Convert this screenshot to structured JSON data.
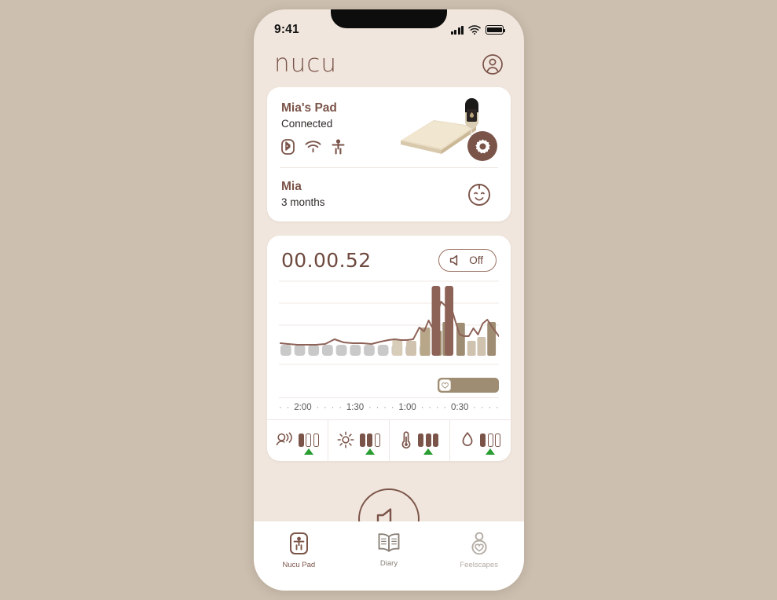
{
  "status_bar": {
    "time": "9:41",
    "cellular_icon": "signal-bars-icon",
    "wifi_icon": "wifi-icon",
    "battery_icon": "battery-full-icon"
  },
  "header": {
    "logo": "nucu",
    "account_icon": "account-circle-icon"
  },
  "device_card": {
    "name": "Mia's Pad",
    "status": "Connected",
    "connectivity_icons": [
      "bluetooth-icon",
      "wifi-icon",
      "baby-icon"
    ],
    "product_image": "nucu-pad-illustration",
    "settings_icon": "gear-icon",
    "baby": {
      "name": "Mia",
      "age": "3 months",
      "avatar_icon": "baby-face-icon"
    }
  },
  "monitor_card": {
    "timer": "00.00.52",
    "sound_toggle": {
      "icon": "speaker-icon",
      "label": "Off"
    },
    "progress": {
      "badge_icon": "heart-icon"
    },
    "axis_labels": [
      "2:00",
      "1:30",
      "1:00",
      "0:30"
    ],
    "sensors": [
      {
        "icon": "sound-icon",
        "level": 1,
        "max": 3,
        "trend": "up"
      },
      {
        "icon": "brightness-icon",
        "level": 2,
        "max": 3,
        "trend": "up"
      },
      {
        "icon": "temperature-icon",
        "level": 3,
        "max": 3,
        "trend": "up"
      },
      {
        "icon": "humidity-icon",
        "level": 1,
        "max": 3,
        "trend": "up"
      }
    ]
  },
  "play_button": {
    "icon": "speaker-icon"
  },
  "tab_bar": {
    "tabs": [
      {
        "label": "Nucu Pad",
        "icon": "nucu-pad-icon",
        "active": true
      },
      {
        "label": "Diary",
        "icon": "book-icon",
        "active": false
      },
      {
        "label": "Feelscapes",
        "icon": "feelscapes-icon",
        "active": false
      }
    ]
  },
  "colors": {
    "page_background": "#ccbfaf",
    "screen_background": "#f0e6dd",
    "card": "#ffffff",
    "brand_brown": "#7b5449",
    "accent_tan": "#9e8c73",
    "bar_dark": "#8d6257",
    "bar_light": "#cfc2ae",
    "trend_green": "#2a9d32",
    "placeholder_gray": "#c9c9c9"
  },
  "chart_data": {
    "type": "bar",
    "title": "",
    "xlabel": "",
    "ylabel": "",
    "x_tick_labels": [
      "2:00",
      "1:30",
      "1:00",
      "0:30"
    ],
    "grid": true,
    "ylim": [
      0,
      100
    ],
    "placeholder_slots": 11,
    "bars": [
      {
        "value": 20,
        "color": "#d8cdb9"
      },
      {
        "value": 18,
        "color": "#cfc2ae"
      },
      {
        "value": 34,
        "color": "#b8a689"
      },
      {
        "value": 30,
        "color": "#a89madd"
      },
      {
        "value": 41,
        "color": "#9e8c73"
      },
      {
        "value": 88,
        "color": "#8d6257"
      },
      {
        "value": 88,
        "color": "#8d6257"
      },
      {
        "value": 40,
        "color": "#9e8c73"
      },
      {
        "value": 18,
        "color": "#cfc2ae"
      },
      {
        "value": 24,
        "color": "#cfc2ae"
      },
      {
        "value": 24,
        "color": "#cfc2ae"
      },
      {
        "value": 42,
        "color": "#9e8c73"
      }
    ],
    "line_series": {
      "name": "sound-level",
      "color": "#8d6257",
      "values": [
        16,
        15,
        14,
        14,
        14,
        15,
        22,
        17,
        16,
        16,
        15,
        18,
        20,
        21,
        20,
        20,
        21,
        37,
        30,
        45,
        34,
        48,
        70,
        62,
        66,
        44,
        26,
        23,
        23,
        33,
        26,
        40,
        46,
        38,
        30,
        22
      ]
    }
  }
}
